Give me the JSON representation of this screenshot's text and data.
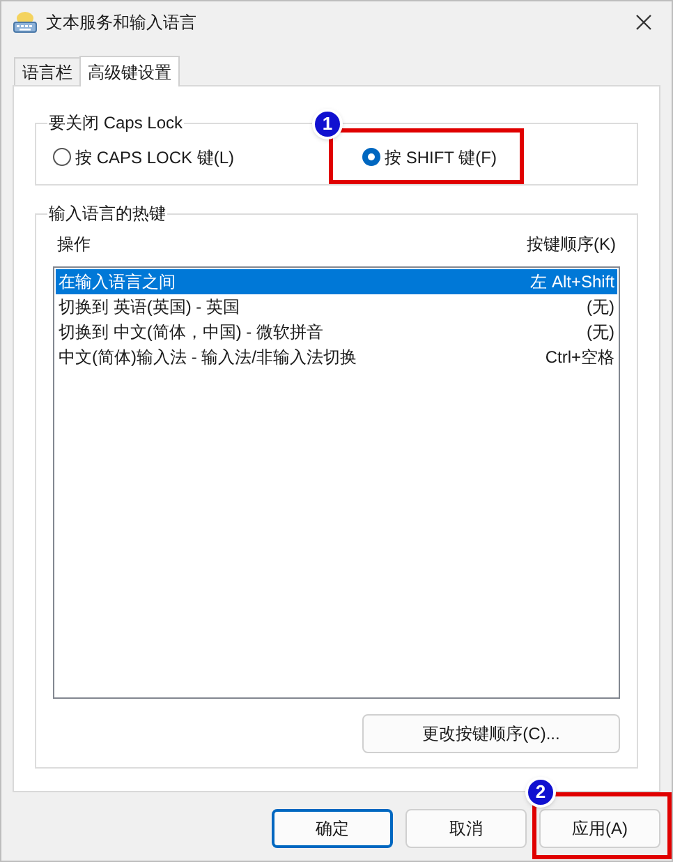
{
  "window": {
    "title": "文本服务和输入语言"
  },
  "tabs": [
    {
      "label": "语言栏",
      "selected": false
    },
    {
      "label": "高级键设置",
      "selected": true
    }
  ],
  "caps_lock_group": {
    "title": "要关闭 Caps Lock",
    "options": [
      {
        "label": "按 CAPS LOCK 键(L)",
        "selected": false
      },
      {
        "label": "按 SHIFT 键(F)",
        "selected": true
      }
    ]
  },
  "hotkeys_group": {
    "title": "输入语言的热键",
    "columns": [
      "操作",
      "按键顺序(K)"
    ],
    "rows": [
      {
        "action": "在输入语言之间",
        "keys": "左 Alt+Shift",
        "selected": true
      },
      {
        "action": "切换到 英语(英国) - 英国",
        "keys": "(无)",
        "selected": false
      },
      {
        "action": "切换到 中文(简体，中国) - 微软拼音",
        "keys": "(无)",
        "selected": false
      },
      {
        "action": "中文(简体)输入法 - 输入法/非输入法切换",
        "keys": "Ctrl+空格",
        "selected": false
      }
    ],
    "change_button": "更改按键顺序(C)..."
  },
  "buttons": [
    {
      "label": "确定",
      "default": true
    },
    {
      "label": "取消",
      "default": false
    },
    {
      "label": "应用(A)",
      "default": false
    }
  ],
  "annotations": [
    {
      "number": "1"
    },
    {
      "number": "2"
    }
  ]
}
